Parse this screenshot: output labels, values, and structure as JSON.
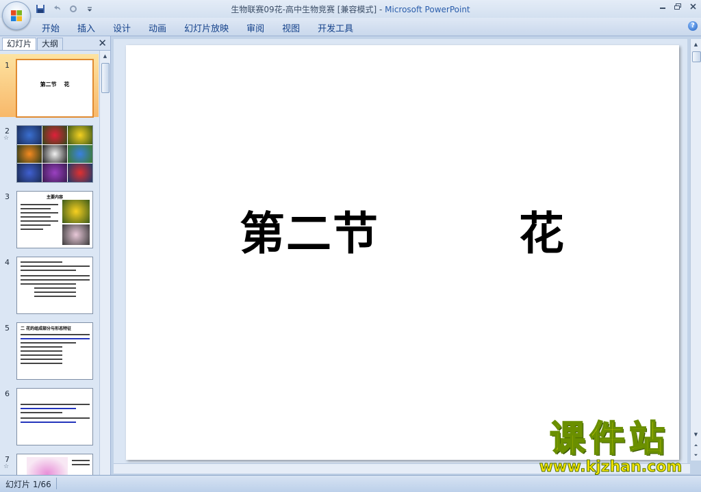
{
  "window": {
    "title": "生物联赛09花-高中生物竞赛 [兼容模式]",
    "separator": " - ",
    "app_name": "Microsoft PowerPoint"
  },
  "ribbon": {
    "tabs": [
      "开始",
      "插入",
      "设计",
      "动画",
      "幻灯片放映",
      "审阅",
      "视图",
      "开发工具"
    ]
  },
  "panel": {
    "tab_slides": "幻灯片",
    "tab_outline": "大纲",
    "thumbnails": [
      {
        "number": "1",
        "title": "第二节　 花"
      },
      {
        "number": "2",
        "star": "☆"
      },
      {
        "number": "3",
        "heading": "主要内容"
      },
      {
        "number": "4"
      },
      {
        "number": "5",
        "heading": "二 花的组成部分与形态特征"
      },
      {
        "number": "6"
      },
      {
        "number": "7",
        "star": "☆"
      }
    ]
  },
  "slide": {
    "title": "第二节　　　花"
  },
  "status": {
    "slide_counter": "幻灯片 1/66"
  },
  "watermark": {
    "main": "课件站",
    "url": "www.kjzhan.com"
  },
  "colors": {
    "accent_blue": "#15428b",
    "selected_thumb": "#f8b86a",
    "watermark_yellow": "#f6e600"
  }
}
